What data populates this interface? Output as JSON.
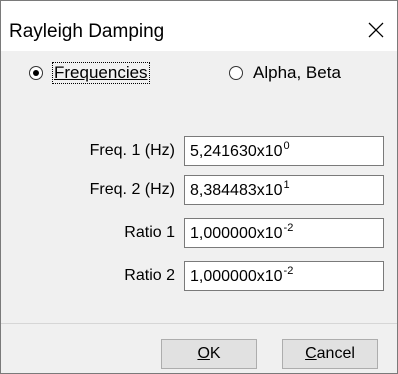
{
  "window": {
    "title": "Rayleigh Damping"
  },
  "mode": {
    "options": [
      {
        "label": "Frequencies",
        "checked": true
      },
      {
        "label": "Alpha, Beta",
        "checked": false
      }
    ]
  },
  "fields": [
    {
      "label": "Freq. 1 (Hz)",
      "mantissa": "5,241630",
      "times": "x",
      "base": "10",
      "exponent": "0"
    },
    {
      "label": "Freq. 2 (Hz)",
      "mantissa": "8,384483",
      "times": "x",
      "base": "10",
      "exponent": "1"
    },
    {
      "label": "Ratio 1",
      "mantissa": "1,000000",
      "times": "x",
      "base": "10",
      "exponent": "-2"
    },
    {
      "label": "Ratio 2",
      "mantissa": "1,000000",
      "times": "x",
      "base": "10",
      "exponent": "-2"
    }
  ],
  "buttons": {
    "ok_mnemonic": "O",
    "ok_rest": "K",
    "cancel_mnemonic": "C",
    "cancel_rest": "ancel"
  },
  "icons": {
    "close": "close-icon"
  }
}
